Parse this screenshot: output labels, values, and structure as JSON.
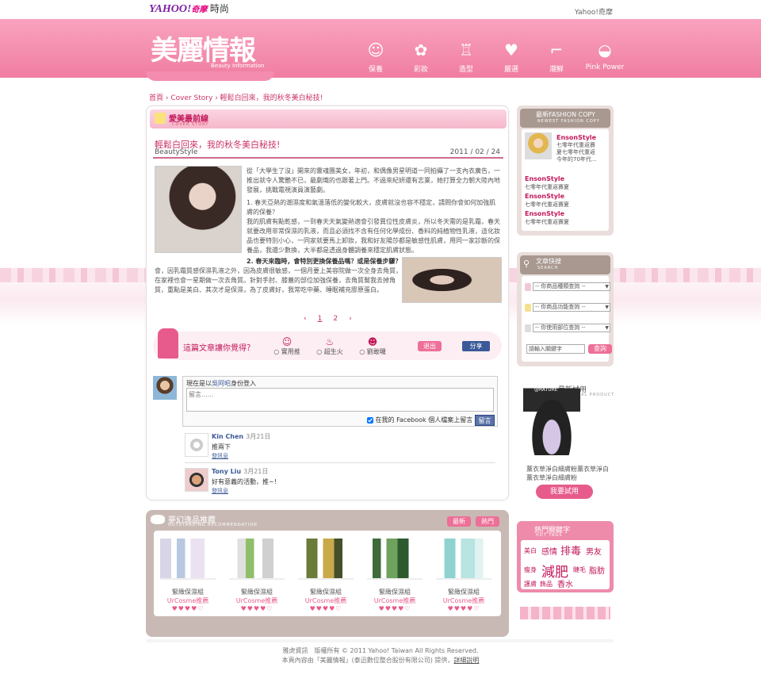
{
  "top": {
    "brand": "YAHOO!",
    "brand_sub": "奇摩",
    "section": "時尚",
    "link": "Yahoo!奇摩"
  },
  "header": {
    "title": "美麗情報",
    "subtitle": "Beauty Information"
  },
  "nav": [
    {
      "label": "保養",
      "icon": "face-icon"
    },
    {
      "label": "彩妝",
      "icon": "makeup-icon"
    },
    {
      "label": "造型",
      "icon": "dress-icon"
    },
    {
      "label": "嚴選",
      "icon": "heart-icon"
    },
    {
      "label": "潮鮮",
      "icon": "heel-icon"
    },
    {
      "label": "Pink Power",
      "icon": "lips-icon"
    }
  ],
  "breadcrumb": {
    "home": "首頁",
    "cover": "Cover Story",
    "current": "輕鬆白回來，我的秋冬美白秘技!"
  },
  "section": {
    "title": "愛美最前線",
    "subtitle": "COVER STORY"
  },
  "article": {
    "title": "輕鬆白回來，我的秋冬美白秘技!",
    "source": "BeautyStyle",
    "date": "2011 / 02 / 24",
    "p1": "從「大學生了沒」開來的靈魂團美女，年初，和偶像男星明道一同拍攝了一支內衣廣告，一推出就令人驚艷不已，最劇熾的也跟著上門。不過來紀妍還有志業，她打算全力朝大陸內地發展，挑戰電視演員演藝劇。",
    "p2": "1. 春天亞熱的潮濕度和氣溫落低的變化較大，皮膚就沒也容不穩定，請問你會如何加強肌膚的保養？",
    "p3": "我的肌膚有點乾感，一到春天天氣變熱適會引發異位性皮膚炎，所以冬天需的是乳霜，春天就要改用非常保濕的乳液，而且必須找不含有任何化學成份、香料的純植物性乳液，這化妝品也要特別小心，一同家就要馬上卸妝，我和好友陽莎都是敏感性肌膚，用同一家診斷的保養品，我還少數換，大半都是透過身體調養來穩定肌膚狀態。",
    "p4_q": "2. 春天來臨時，會特別更換保養品嗎？或是保養步驟？",
    "p5": "會，因乳霜質感保濕乳液之外，因為皮膚很敏感，一個月要上美容院做一次全身去角質，在家裡也會一星期做一次去角質。針對手肘、膝蓋的部位加強保養，去角質幫我去掉角質，重點是美白、其次才是保濕，為了皮膚好，我常吃中藥、睡眠補充膠原蛋白。"
  },
  "pager": {
    "prev": "‹",
    "pages": [
      "1",
      "2"
    ],
    "next": "›"
  },
  "feedback": {
    "question": "這篇文章讓你覺得？",
    "options": [
      {
        "label": "實用推",
        "icon": "smile-icon"
      },
      {
        "label": "超生火",
        "icon": "fire-icon"
      },
      {
        "label": "劉敢囉",
        "icon": "devil-icon"
      }
    ],
    "back": "退出",
    "share": "分享"
  },
  "comment_form": {
    "login_prefix": "現在是以",
    "login_user": "吳阿昭",
    "login_suffix": "身份登入",
    "placeholder": "留言......",
    "post_label": "在我的 Facebook 個人檔案上留言",
    "submit": "留言"
  },
  "comments": [
    {
      "name": "Kin Chen",
      "date": "3月21日",
      "text": "推兩下",
      "link": "發訊息"
    },
    {
      "name": "Tony Liu",
      "date": "3月21日",
      "text": "好有意義的活動，推~!",
      "link": "發訊息"
    }
  ],
  "recommend": {
    "title": "夢幻逸品推薦",
    "subtitle": "OUTSTANDING RECOMMENDATION",
    "tab_new": "最新",
    "tab_hot": "熱門",
    "products": [
      {
        "name": "緊緻保濕組",
        "brand": "UrCosme推薦",
        "rating": "♥♥♥♥♡"
      },
      {
        "name": "緊緻保濕組",
        "brand": "UrCosme推薦",
        "rating": "♥♥♥♥♡"
      },
      {
        "name": "緊緻保濕組",
        "brand": "UrCosme推薦",
        "rating": "♥♥♥♥♡"
      },
      {
        "name": "緊緻保濕組",
        "brand": "UrCosme推薦",
        "rating": "♥♥♥♥♡"
      },
      {
        "name": "緊緻保濕組",
        "brand": "UrCosme推薦",
        "rating": "♥♥♥♥♡"
      }
    ]
  },
  "fashion": {
    "title": "最新FASHION COPY",
    "subtitle": "NEWEST FASHION COPY",
    "featured": {
      "name": "EnsonStyle",
      "text1": "七零年代重返賽",
      "text2": "夏七零年代重返",
      "text3": "今年的70年代..."
    },
    "items": [
      {
        "name": "EnsonStyle",
        "text": "七零年代重返賽夏"
      },
      {
        "name": "EnsonStyle",
        "text": "七零年代重返賽夏"
      },
      {
        "name": "EnsonStyle",
        "text": "七零年代重返賽夏"
      }
    ]
  },
  "search": {
    "title": "文章快搜",
    "subtitle": "SEARCH",
    "selects": [
      "-- 你商品種類查詢 --",
      "-- 你商品功能查詢 --",
      "-- 你使用部位查詢 --"
    ],
    "keyword_placeholder": "請輸入關鍵字",
    "button": "查詢"
  },
  "trial": {
    "title": "最新試用",
    "subtitle": "TRIAL PRODUCT",
    "jar_label": "@RATURE",
    "desc": "薰衣草淨白細膚粉薰衣草淨白薰衣草淨白細膚粉",
    "button": "我要試用"
  },
  "tags": {
    "title": "熱門關鍵字",
    "subtitle": "HOT TAGS",
    "items": [
      "美白",
      "感情",
      "排毒",
      "男友",
      "瘦身",
      "減肥",
      "睫毛",
      "脂肪",
      "護膚",
      "飾品",
      "香水"
    ]
  },
  "footer": {
    "line1": "雅虎資訊　版權所有 © 2011 Yahoo! Taiwan All Rights Reserved.",
    "line2": "本頁內容由「美麗情報」(泰迅數位整合股份有限公司) 提供，",
    "link": "詳細說明"
  },
  "colors": {
    "accent": "#e75b8c",
    "brand_pink": "#f07da1",
    "facebook": "#3b5998"
  }
}
